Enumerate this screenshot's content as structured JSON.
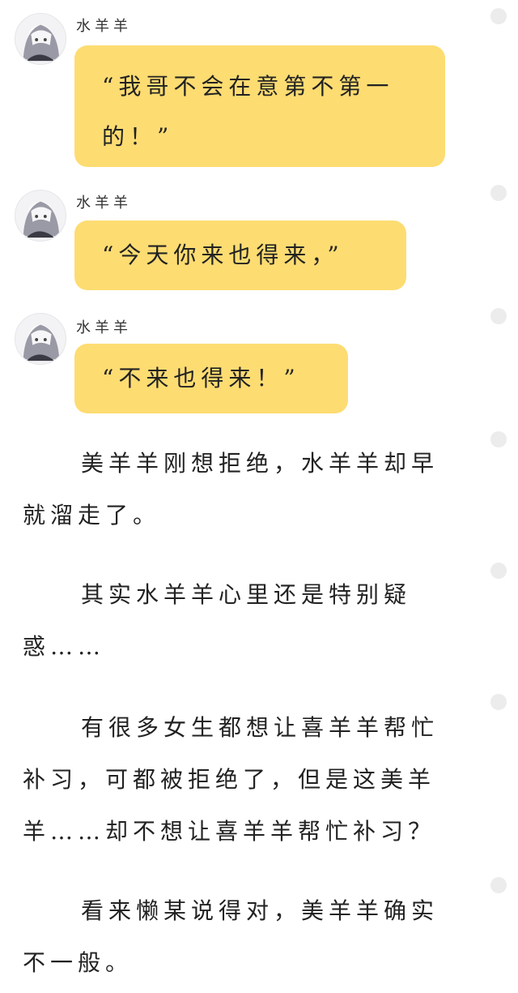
{
  "messages": [
    {
      "speaker": "水羊羊",
      "lines": [
        "“我哥不会在意第不第一",
        "的！”"
      ]
    },
    {
      "speaker": "水羊羊",
      "lines": [
        "“今天你来也得来，”"
      ]
    },
    {
      "speaker": "水羊羊",
      "lines": [
        "“不来也得来！”"
      ]
    }
  ],
  "narration": [
    {
      "lines": [
        "美羊羊刚想拒绝，水羊羊却早",
        "就溜走了。"
      ]
    },
    {
      "lines": [
        "其实水羊羊心里还是特别疑",
        "惑……"
      ]
    },
    {
      "lines": [
        "有很多女生都想让喜羊羊帮忙",
        "补习，可都被拒绝了，但是这美羊",
        "羊……却不想让喜羊羊帮忙补习？"
      ]
    },
    {
      "lines": [
        "看来懒某说得对，美羊羊确实",
        "不一般。"
      ]
    }
  ],
  "colors": {
    "bubble": "#fddc72",
    "dot": "#ececec",
    "text": "#222222"
  }
}
